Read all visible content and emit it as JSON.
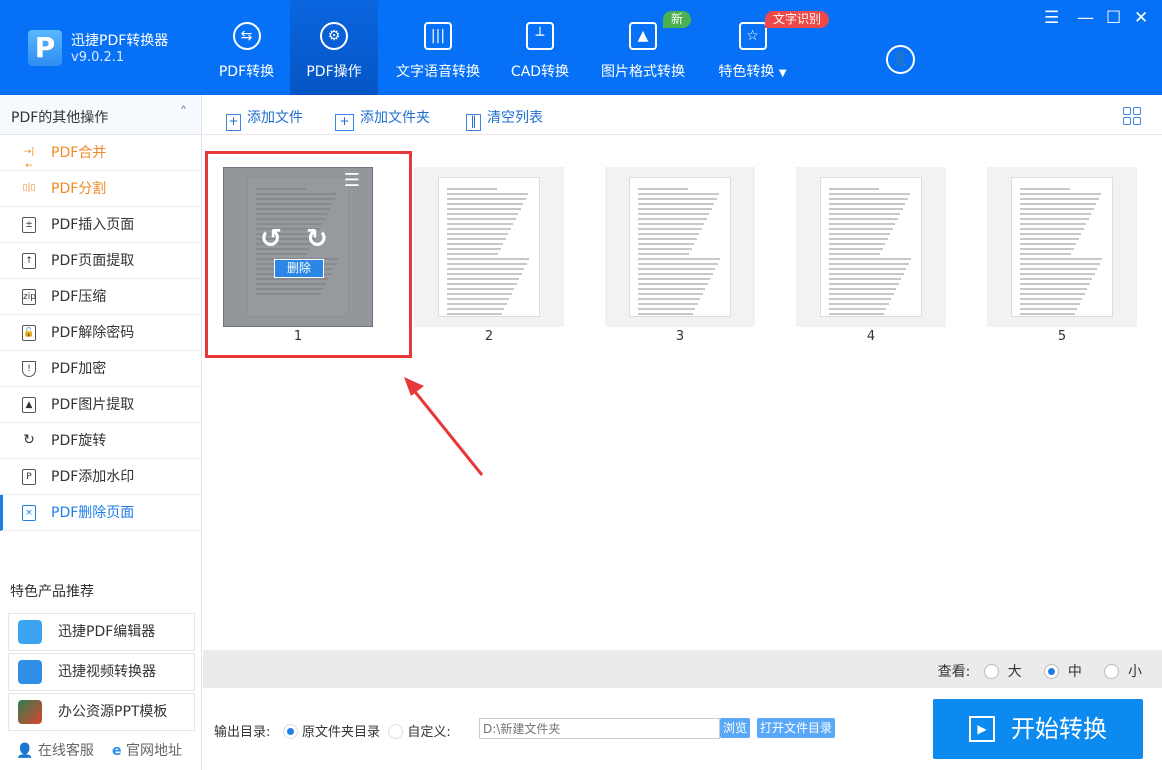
{
  "app": {
    "name": "迅捷PDF转换器",
    "version": "v9.0.2.1"
  },
  "tabs": [
    {
      "label": "PDF转换"
    },
    {
      "label": "PDF操作"
    },
    {
      "label": "文字语音转换"
    },
    {
      "label": "CAD转换"
    },
    {
      "label": "图片格式转换",
      "badge": "新"
    },
    {
      "label": "特色转换",
      "badge": "文字识别"
    }
  ],
  "sidebar": {
    "title": "PDF的其他操作",
    "items": [
      {
        "label": "PDF合并"
      },
      {
        "label": "PDF分割"
      },
      {
        "label": "PDF插入页面"
      },
      {
        "label": "PDF页面提取"
      },
      {
        "label": "PDF压缩"
      },
      {
        "label": "PDF解除密码"
      },
      {
        "label": "PDF加密"
      },
      {
        "label": "PDF图片提取"
      },
      {
        "label": "PDF旋转"
      },
      {
        "label": "PDF添加水印"
      },
      {
        "label": "PDF删除页面"
      }
    ],
    "featured_title": "特色产品推荐",
    "featured": [
      {
        "label": "迅捷PDF编辑器"
      },
      {
        "label": "迅捷视频转换器"
      },
      {
        "label": "办公资源PPT模板"
      }
    ],
    "links": {
      "service": "在线客服",
      "website": "官网地址"
    }
  },
  "toolbar": {
    "add_file": "添加文件",
    "add_folder": "添加文件夹",
    "clear": "清空列表"
  },
  "pages": [
    "1",
    "2",
    "3",
    "4",
    "5"
  ],
  "thumb_overlay": {
    "delete": "删除"
  },
  "view": {
    "label": "查看:",
    "options": [
      "大",
      "中",
      "小"
    ],
    "selected": "中"
  },
  "output": {
    "label": "输出目录:",
    "original": "原文件夹目录",
    "custom": "自定义:",
    "path_placeholder": "D:\\新建文件夹",
    "browse": "浏览",
    "open_folder": "打开文件目录"
  },
  "start": "开始转换",
  "colors": {
    "header": "#0671f6",
    "accent": "#1e7ee8",
    "annotation": "#e8393a"
  }
}
